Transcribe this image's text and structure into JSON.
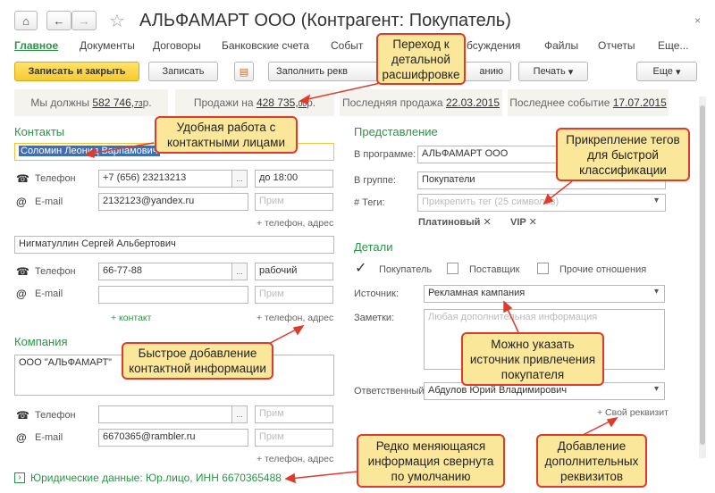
{
  "window": {
    "title": "АЛЬФАМАРТ ООО (Контрагент: Покупатель)",
    "close": "×"
  },
  "nav": {
    "home": "⌂",
    "back": "←",
    "forward": "→",
    "star": "☆"
  },
  "tabs": [
    "Главное",
    "Документы",
    "Договоры",
    "Банковские счета",
    "Событ",
    "бсуждения",
    "Файлы",
    "Отчеты",
    "Еще..."
  ],
  "toolbar": {
    "save_close": "Записать и закрыть",
    "save": "Записать",
    "fill": "Заполнить рекв",
    "fill_tail": "анию",
    "print": "Печать",
    "more": "Еще"
  },
  "info": {
    "owe_prefix": "Мы должны ",
    "owe_value": "582 746,",
    "owe_cents": "73",
    "owe_suffix": " р.",
    "sales_prefix": "Продажи на ",
    "sales_value": "428 735,",
    "sales_cents": "00",
    "sales_suffix": " р.",
    "last_sale_prefix": "Последняя продажа ",
    "last_sale_date": "22.03.2015",
    "last_event_prefix": "Последнее событие ",
    "last_event_date": "17.07.2015"
  },
  "contacts": {
    "header": "Контакты",
    "c1": {
      "name": "Соломин Леонид Варпамович",
      "phone_label": "Телефон",
      "phone": "+7 (656) 23213213",
      "phone_note": "до 18:00",
      "email_label": "E-mail",
      "email": "2132123@yandex.ru",
      "note_ph": "Прим",
      "add": "+ телефон, адрес"
    },
    "c2": {
      "name": "Нигматуллин Сергей Альбертович",
      "phone_label": "Телефон",
      "phone": "66-77-88",
      "phone_note": "рабочий",
      "email_label": "E-mail",
      "email": "",
      "note_ph": "Прим",
      "add_contact": "+ контакт",
      "add": "+ телефон, адрес"
    }
  },
  "company": {
    "header": "Компания",
    "name": "ООО \"АЛЬФАМАРТ\"",
    "phone_label": "Телефон",
    "phone": "",
    "email_label": "E-mail",
    "email": "6670365@rambler.ru",
    "note_ph": "Прим",
    "add": "+ телефон, адрес",
    "legal_arrow": "›",
    "legal": "Юридические данные: Юр.лицо, ИНН 6670365488"
  },
  "representation": {
    "header": "Представление",
    "program_label": "В программе:",
    "program": "АЛЬФАМАРТ ООО",
    "group_label": "В группе:",
    "group": "Покупатели",
    "tags_label": "# Теги:",
    "tags_ph": "Прикрепить тег (25 символов)",
    "tag1": "Платиновый",
    "tag2": "VIP",
    "tag_x": "✕"
  },
  "details": {
    "header": "Детали",
    "buyer": "Покупатель",
    "supplier": "Поставщик",
    "other": "Прочие отношения",
    "check": "✓",
    "source_label": "Источник:",
    "source": "Рекламная кампания",
    "notes_label": "Заметки:",
    "notes_ph": "Любая дополнительная информация",
    "resp_label": "Ответственный:",
    "resp": "Абдулов Юрий Владимирович",
    "add_req": "+ Свой реквизит"
  },
  "callouts": {
    "drilldown": "Переход к детальной расшифровке",
    "contacts": "Удобная работа с контактными лицами",
    "tags": "Прикрепление тегов для быстрой классификации",
    "contact_info": "Быстрое добавление контактной информации",
    "source": "Можно указать источник привлечения покупателя",
    "collapsed": "Редко меняющаяся информация свернута по умолчанию",
    "requisites": "Добавление дополнительных реквизитов"
  },
  "colors": {
    "green": "#2a9446",
    "callout_bg": "#fbe79a",
    "callout_border": "#e03a2a",
    "primary": "#f6c931"
  },
  "icons": {
    "phone": "☎",
    "email": "@",
    "dots": "...",
    "dropdown": "▾"
  }
}
